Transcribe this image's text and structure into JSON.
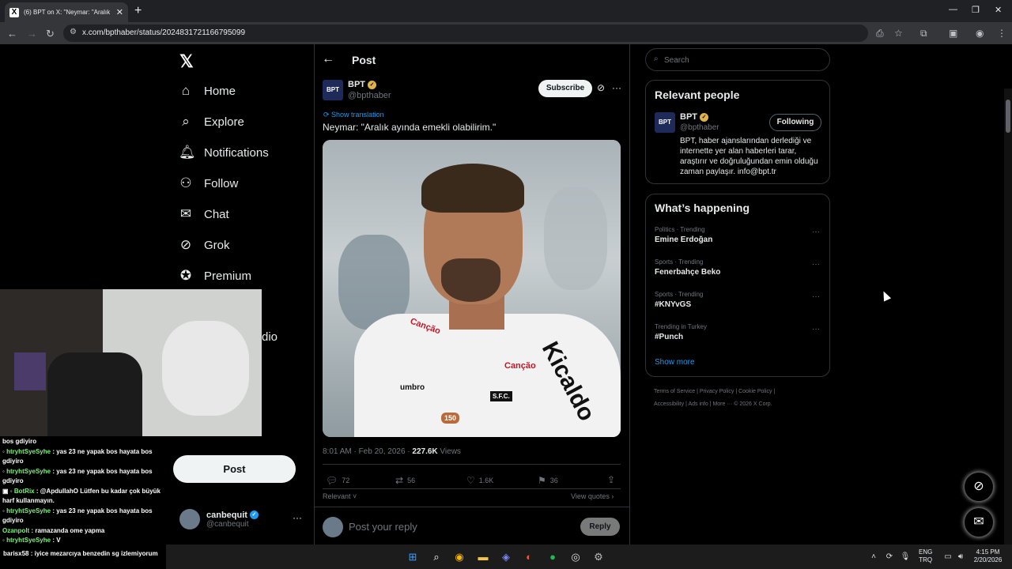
{
  "browser": {
    "tab_title": "(6) BPT on X: \"Neymar: \"Aralık a",
    "url": "x.com/bpthaber/status/2024831721166795099"
  },
  "sidebar": {
    "items": [
      {
        "label": "Home",
        "icon": "home-icon"
      },
      {
        "label": "Explore",
        "icon": "search-icon"
      },
      {
        "label": "Notifications",
        "icon": "bell-icon"
      },
      {
        "label": "Follow",
        "icon": "person-add-icon"
      },
      {
        "label": "Chat",
        "icon": "mail-icon"
      },
      {
        "label": "Grok",
        "icon": "grok-icon"
      },
      {
        "label": "Premium",
        "icon": "premium-icon"
      }
    ],
    "partial_item": "dio",
    "post_button": "Post",
    "profile": {
      "name": "canbequit",
      "handle": "@canbequit"
    }
  },
  "overlay_chat": {
    "lines": [
      {
        "user": "",
        "text": "bos gdiyiro"
      },
      {
        "user": "htryhtSyeSyhe",
        "text": ": yas 23 ne yapak bos hayata bos gdiyiro"
      },
      {
        "user": "htryhtSyeSyhe",
        "text": ": yas 23 ne yapak bos hayata bos gdiyiro"
      },
      {
        "user": "BotRix",
        "text": ": @ApdullahO Lütfen bu kadar çok büyük harf kullanmayın."
      },
      {
        "user": "htryhtSyeSyhe",
        "text": ": yas 23 ne yapak bos hayata bos gdiyiro"
      },
      {
        "user": "Ozanpolt",
        "text": ": ramazanda ome yapma"
      },
      {
        "user": "htryhtSyeSyhe",
        "text": ": V"
      }
    ],
    "last_line": {
      "user": "barisx58",
      "text": ": iyice mezarcıya benzedin sg izlemiyorum"
    }
  },
  "post": {
    "header_title": "Post",
    "author": "BPT",
    "handle": "@bpthaber",
    "avatar_text": "BPT",
    "subscribe_label": "Subscribe",
    "show_translation": "Show translation",
    "text": "Neymar: \"Aralık ayında emekli olabilirim.\"",
    "photo_text": {
      "sponsor1": "Canção",
      "sponsor2": "Canção",
      "brand": "umbro",
      "kit": "Kicaldo",
      "badge": "150",
      "crest": "S.F.C."
    },
    "time": "8:01 AM · Feb 20, 2026 · ",
    "views": "227.6K",
    "views_label": " Views",
    "actions": {
      "replies": "72",
      "reposts": "56",
      "likes": "1.6K",
      "bookmarks": "36"
    },
    "relevant_label": "Relevant",
    "view_quotes": "View quotes",
    "reply_placeholder": "Post your reply",
    "reply_button": "Reply"
  },
  "right": {
    "search_placeholder": "Search",
    "relevant_people_title": "Relevant people",
    "person": {
      "name": "BPT",
      "handle": "@bpthaber",
      "following_label": "Following",
      "bio": "BPT, haber ajanslarından derlediği ve internette yer alan haberleri tarar, araştırır ve doğruluğundan emin olduğu zaman paylaşır. info@bpt.tr"
    },
    "happening_title": "What’s happening",
    "trends": [
      {
        "context": "Politics · Trending",
        "name": "Emine Erdoğan"
      },
      {
        "context": "Sports · Trending",
        "name": "Fenerbahçe Beko"
      },
      {
        "context": "Sports · Trending",
        "name": "#KNYvGS"
      },
      {
        "context": "Trending in Turkey",
        "name": "#Punch"
      }
    ],
    "show_more": "Show more",
    "footer_line1": "Terms of Service  |  Privacy Policy  |  Cookie Policy  |",
    "footer_line2": "Accessibility  |  Ads info  |  More ···  © 2026 X Corp."
  },
  "taskbar": {
    "lang1": "ENG",
    "lang2": "TRQ",
    "time": "4:15 PM",
    "date": "2/20/2026"
  },
  "colors": {
    "accent": "#1d9bf0",
    "verified_gold": "#e0b34a"
  }
}
